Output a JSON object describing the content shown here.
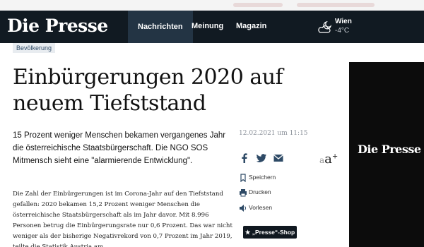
{
  "header": {
    "logo": "Die Presse",
    "nav": [
      "Nachrichten",
      "Meinung",
      "Magazin"
    ],
    "weather": {
      "city": "Wien",
      "temp": "-4°C",
      "icon": "cloud-moon-icon"
    }
  },
  "article": {
    "category": "Bevölkerung",
    "headline": "Einbürgerungen 2020 auf neuem Tiefststand",
    "lead": "15 Prozent weniger Menschen bekamen vergangenes Jahr die österreichische Staatsbürgerschaft. Die NGO SOS Mitmensch sieht eine \"alarmierende Entwicklung\".",
    "body": "Die Zahl der Einbürgerungen ist im Corona-Jahr auf den Tiefststand gefallen: 2020 bekamen 15,2 Prozent weniger Menschen die österreichische Staatsbürgerschaft als im Jahr davor. Mit 8.996 Personen betrug die Einbürgerungsrate nur 0,6 Prozent. Das war nicht weniger als der bisherige Negativrekord von 0,7 Prozent im Jahr 2019, teilte die Statistik Austria am",
    "date": "12.02.2021 um 11:15"
  },
  "share": {
    "icons": [
      "facebook-icon",
      "twitter-icon",
      "email-icon"
    ]
  },
  "font_size": {
    "small": "a",
    "large": "a",
    "plus": "+"
  },
  "actions": [
    {
      "label": "Speichern",
      "icon": "bookmark-icon"
    },
    {
      "label": "Drucken",
      "icon": "print-icon"
    },
    {
      "label": "Vorlesen",
      "icon": "speaker-icon"
    }
  ],
  "ad": {
    "logo": "Die Presse"
  },
  "shop": {
    "label": "„Presse“-Shop",
    "star": "★"
  },
  "colors": {
    "header_bg": "#111a22",
    "accent": "#2e4a66",
    "ad_bg": "#0c0c0c"
  }
}
